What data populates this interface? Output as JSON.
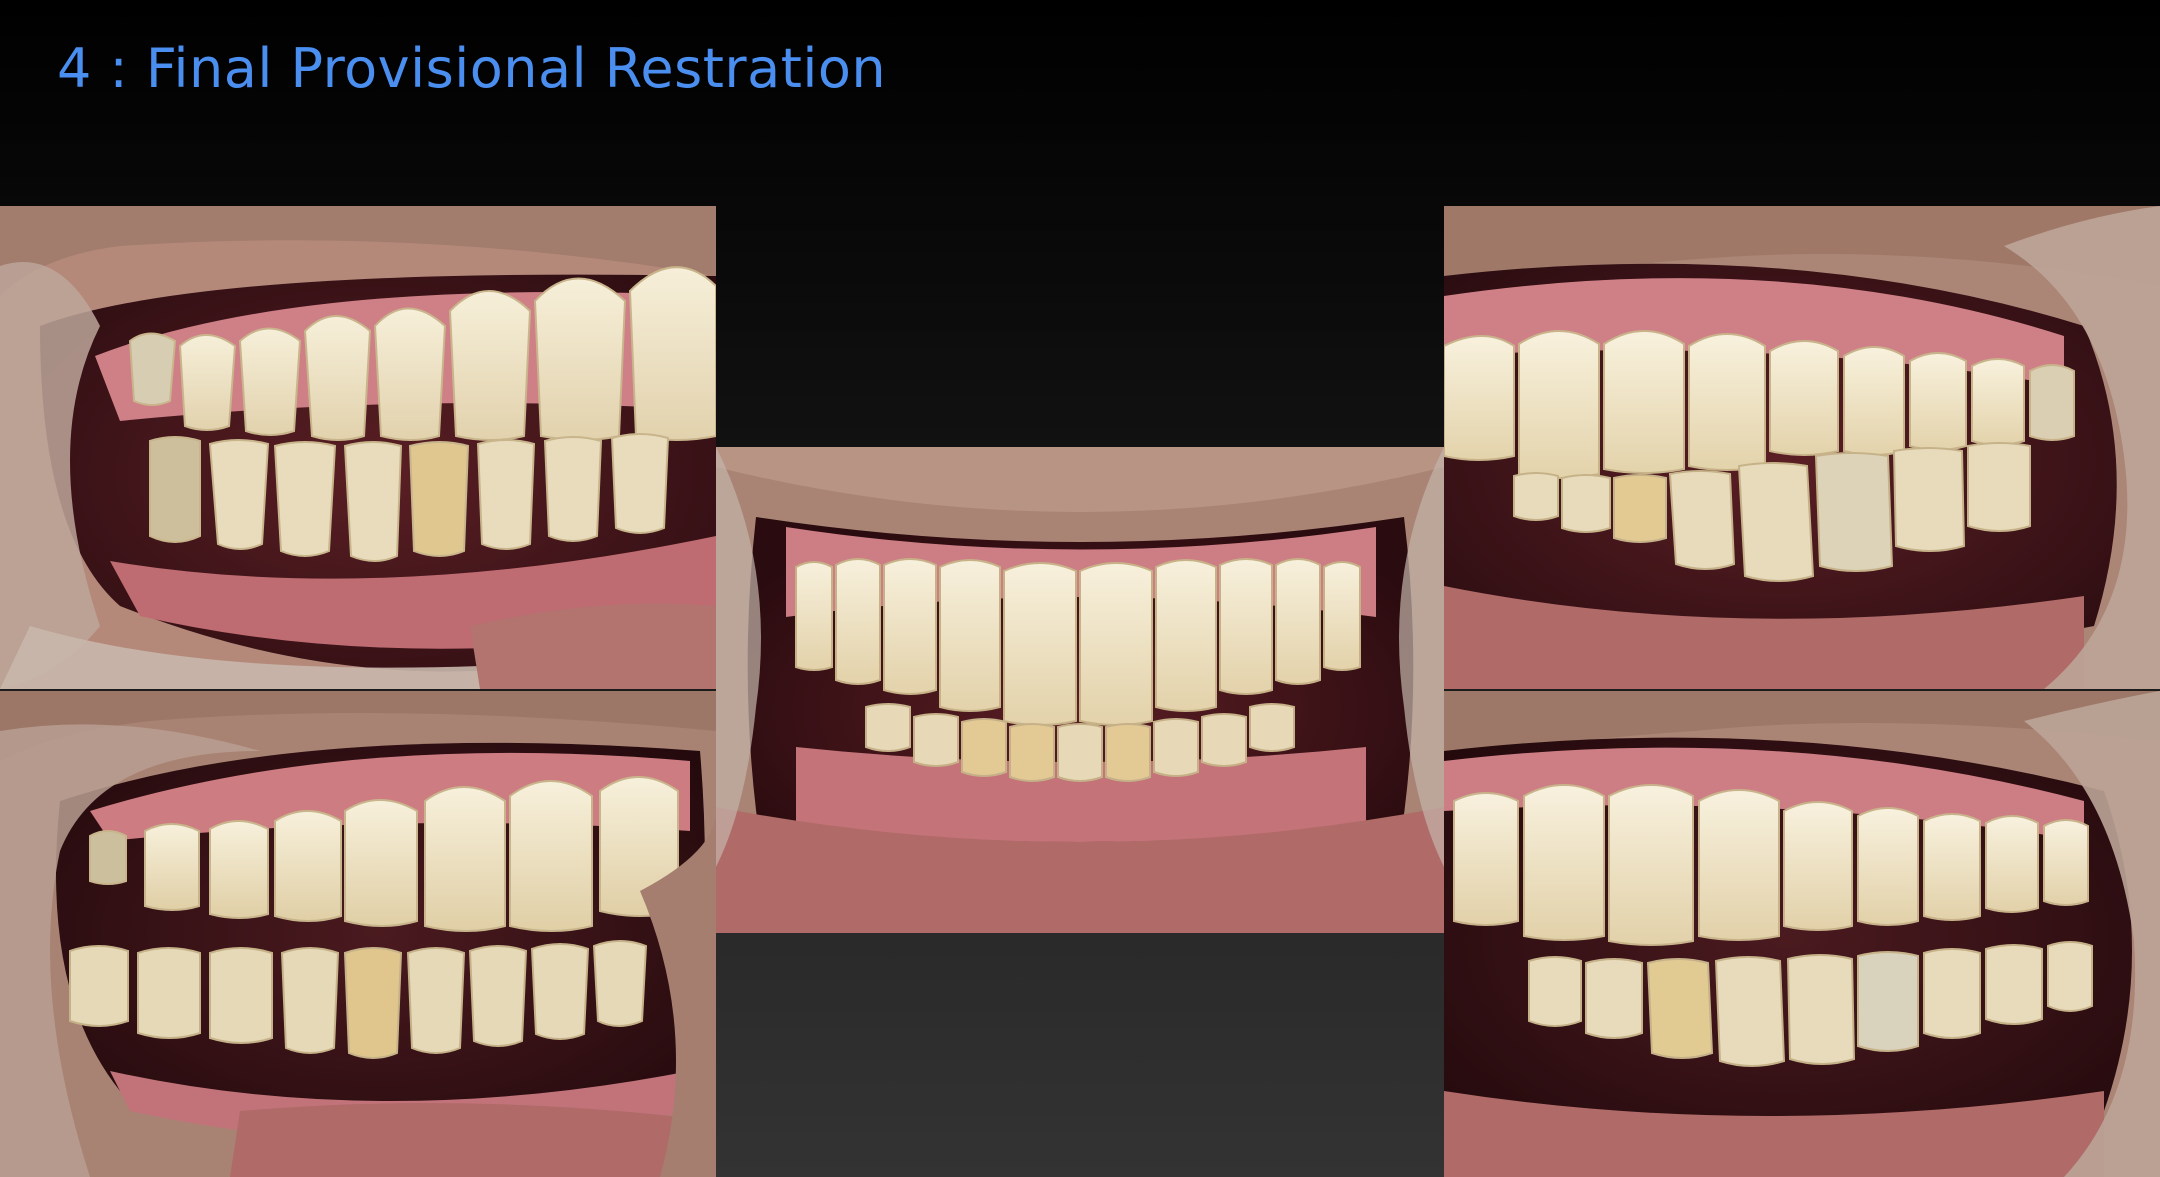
{
  "slide": {
    "title": "4 : Final Provisional Restration"
  },
  "photos": [
    {
      "id": "upper-left",
      "view": "right-lateral-view"
    },
    {
      "id": "lower-left",
      "view": "right-lateral-view"
    },
    {
      "id": "center",
      "view": "frontal-view"
    },
    {
      "id": "upper-right",
      "view": "left-lateral-view"
    },
    {
      "id": "lower-right",
      "view": "left-lateral-view"
    }
  ],
  "colors": {
    "title": "#4a8ef0",
    "background_top": "#000000",
    "background_bottom": "#333333",
    "gum": "#c9777c",
    "tooth": "#f0e6cc",
    "lip": "#b06a67",
    "skin": "#a88373"
  }
}
